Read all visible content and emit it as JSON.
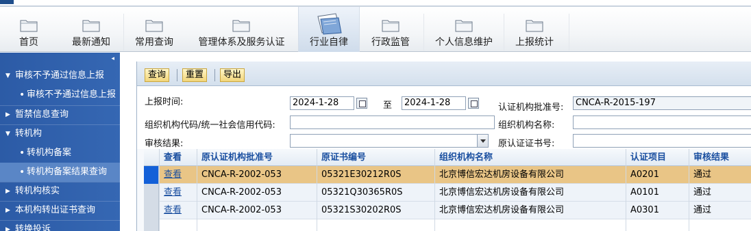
{
  "nav": {
    "items": [
      {
        "label": "首页"
      },
      {
        "label": "最新通知"
      },
      {
        "label": "常用查询"
      },
      {
        "label": "管理体系及服务认证"
      },
      {
        "label": "行业自律"
      },
      {
        "label": "行政监管"
      },
      {
        "label": "个人信息维护"
      },
      {
        "label": "上报统计"
      }
    ],
    "active": "行业自律"
  },
  "sidebar": {
    "collapse_icon": "◂",
    "items": [
      {
        "label": "审核不予通过信息上报",
        "level": 1,
        "expanded": true
      },
      {
        "label": "审核不予通过信息上报",
        "level": 2
      },
      {
        "label": "暂禁信息查询",
        "level": 1,
        "expanded": false
      },
      {
        "label": "转机构",
        "level": 1,
        "expanded": true
      },
      {
        "label": "转机构备案",
        "level": 2
      },
      {
        "label": "转机构备案结果查询",
        "level": 2,
        "selected": true
      },
      {
        "label": "转机构核实",
        "level": 1,
        "expanded": false
      },
      {
        "label": "本机构转出证书查询",
        "level": 1,
        "expanded": false
      },
      {
        "label": "转换投诉",
        "level": 1,
        "expanded": false
      }
    ]
  },
  "toolbar": {
    "query": "查询",
    "reset": "重置",
    "export": "导出"
  },
  "form": {
    "report_time_label": "上报时间:",
    "date_from": "2024-1-28",
    "to_label": "至",
    "date_to": "2024-1-28",
    "approval_no_label": "认证机构批准号:",
    "approval_no": "CNCA-R-2015-197",
    "org_code_label": "组织机构代码/统一社会信用代码:",
    "org_code": "",
    "org_name_label": "组织机构名称:",
    "org_name": "",
    "audit_result_label": "审核结果:",
    "audit_result": "",
    "orig_cert_no_label": "原认证证书号:",
    "orig_cert_no": ""
  },
  "grid": {
    "columns": [
      "查看",
      "原认证机构批准号",
      "原证书编号",
      "组织机构名称",
      "认证项目",
      "审核结果"
    ],
    "rows": [
      {
        "view": "查看",
        "orig_approval": "CNCA-R-2002-053",
        "orig_cert": "05321E30212R0S",
        "org": "北京博信宏达机房设备有限公司",
        "item": "A0201",
        "result": "通过",
        "selected": true
      },
      {
        "view": "查看",
        "orig_approval": "CNCA-R-2002-053",
        "orig_cert": "05321Q30365R0S",
        "org": "北京博信宏达机房设备有限公司",
        "item": "A0101",
        "result": "通过"
      },
      {
        "view": "查看",
        "orig_approval": "CNCA-R-2002-053",
        "orig_cert": "05321S30202R0S",
        "org": "北京博信宏达机房设备有限公司",
        "item": "A0301",
        "result": "通过"
      }
    ]
  },
  "colors": {
    "sidebar_bg": "#3567b3",
    "selected_row": "#e9c586",
    "header_text": "#1a4fa0",
    "toolbar_button": "#f2d57a"
  }
}
